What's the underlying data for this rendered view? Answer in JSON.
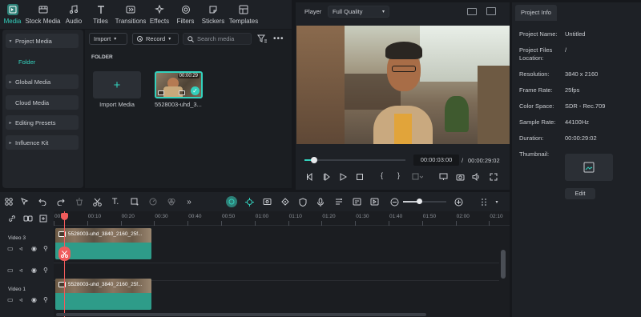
{
  "tabs": [
    {
      "label": "Media",
      "icon": "media-icon",
      "active": true
    },
    {
      "label": "Stock Media",
      "icon": "stock-media-icon"
    },
    {
      "label": "Audio",
      "icon": "audio-icon"
    },
    {
      "label": "Titles",
      "icon": "titles-icon"
    },
    {
      "label": "Transitions",
      "icon": "transitions-icon"
    },
    {
      "label": "Effects",
      "icon": "effects-icon"
    },
    {
      "label": "Filters",
      "icon": "filters-icon"
    },
    {
      "label": "Stickers",
      "icon": "stickers-icon"
    },
    {
      "label": "Templates",
      "icon": "templates-icon"
    }
  ],
  "leftnav": {
    "project_media": "Project Media",
    "folder": "Folder",
    "global_media": "Global Media",
    "cloud_media": "Cloud Media",
    "editing_presets": "Editing Presets",
    "influence_kit": "Influence Kit"
  },
  "media": {
    "import_label": "Import",
    "record_label": "Record",
    "search_placeholder": "Search media",
    "folder_heading": "FOLDER",
    "import_tile_label": "Import Media",
    "clip_name": "5528003-uhd_3...",
    "clip_duration": "00:00:29"
  },
  "player": {
    "label": "Player",
    "quality": "Full Quality",
    "current_time": "00:00:03:00",
    "separator": "/",
    "total_time": "00:00:29:02",
    "progress": 0.06
  },
  "info": {
    "tab": "Project Info",
    "rows": [
      {
        "k": "Project Name:",
        "v": "Untitled"
      },
      {
        "k": "Project Files Location:",
        "v": "/"
      },
      {
        "k": "Resolution:",
        "v": "3840 x 2160"
      },
      {
        "k": "Frame Rate:",
        "v": "25fps"
      },
      {
        "k": "Color Space:",
        "v": "SDR - Rec.709"
      },
      {
        "k": "Sample Rate:",
        "v": "44100Hz"
      },
      {
        "k": "Duration:",
        "v": "00:00:29:02"
      },
      {
        "k": "Thumbnail:",
        "v": ""
      }
    ],
    "edit_label": "Edit"
  },
  "timeline": {
    "ticks": [
      "00:00",
      "00:10",
      "00:20",
      "00:30",
      "00:40",
      "00:50",
      "01:00",
      "01:10",
      "01:20",
      "01:30",
      "01:40",
      "01:50",
      "02:00",
      "02:10"
    ],
    "track_video3": "Video 3",
    "track_video1": "Video 1",
    "clip_label": "5528003-uhd_3840_2160_25f..."
  },
  "colors": {
    "accent": "#33d1bd",
    "playhead": "#f05b5b",
    "clip": "#2e9c89"
  }
}
